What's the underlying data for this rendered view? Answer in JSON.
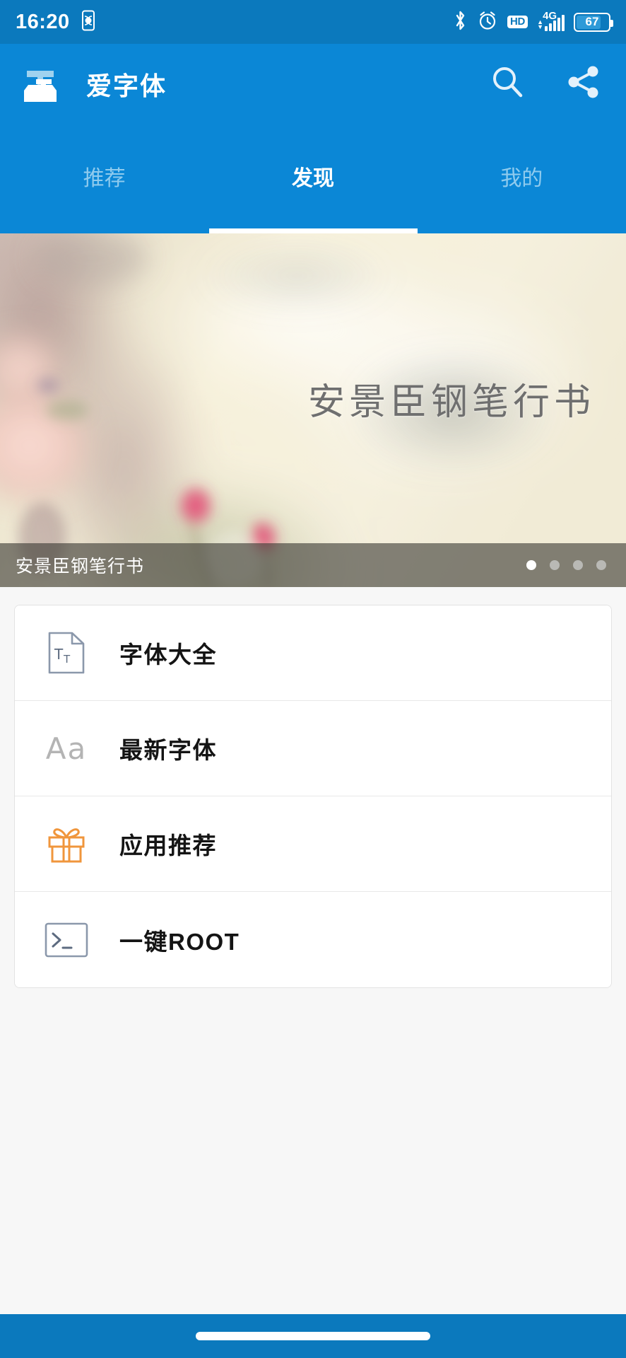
{
  "status_bar": {
    "time": "16:20",
    "icons": {
      "vibrate": "vibrate-icon",
      "bluetooth": "bluetooth-icon",
      "alarm": "alarm-icon",
      "hd": "HD",
      "network_type": "4G",
      "signal": "signal-bars-icon"
    },
    "battery_percent": "67",
    "background": "#0b79bd"
  },
  "app_bar": {
    "logo": "app-logo-icon",
    "title": "爱字体",
    "search_icon": "search-icon",
    "share_icon": "share-icon",
    "background": "#0b87d6"
  },
  "tabs": {
    "items": [
      {
        "label": "推荐",
        "active": false
      },
      {
        "label": "发现",
        "active": true
      },
      {
        "label": "我的",
        "active": false
      }
    ],
    "active_index": 1,
    "indicator_color": "#ffffff",
    "inactive_color": "#8fcbee"
  },
  "banner": {
    "title": "安景臣钢笔行书",
    "caption": "安景臣钢笔行书",
    "dots_total": 4,
    "dots_active_index": 0,
    "title_color": "#6f6f6f"
  },
  "list": {
    "items": [
      {
        "label": "字体大全",
        "icon": "font-document-icon",
        "icon_color": "#8b98ab"
      },
      {
        "label": "最新字体",
        "icon": "aa-text-icon",
        "icon_text": "Aa",
        "icon_color": "#b4b4b4"
      },
      {
        "label": "应用推荐",
        "icon": "gift-icon",
        "icon_color": "#f0963c"
      },
      {
        "label": "一键ROOT",
        "icon": "terminal-icon",
        "icon_color": "#8b98ab"
      }
    ]
  },
  "nav_bar": {
    "gesture_pill": "home-gesture-pill",
    "background": "#0b79bd"
  }
}
